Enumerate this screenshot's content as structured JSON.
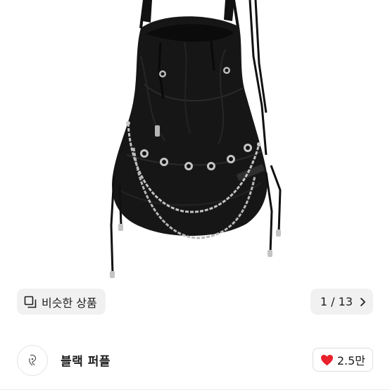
{
  "product": {
    "image_alt": "black drawstring backpack with chains and eyelets",
    "colors": {
      "bag": "#141414",
      "bag_shadow": "#0a0a0a",
      "chain": "#bfbfbf",
      "cord": "#111111"
    }
  },
  "toolbar": {
    "similar_label": "비슷한 상품",
    "similar_icon": "similar-items-icon",
    "counter_label": "1 / 13",
    "counter_icon": "chevron-right-icon"
  },
  "shop": {
    "name": "블랙 퍼플",
    "avatar_icon": "shop-avatar-icon",
    "likes_label": "2.5만",
    "like_icon": "heart-icon",
    "like_color": "#e8212c"
  }
}
